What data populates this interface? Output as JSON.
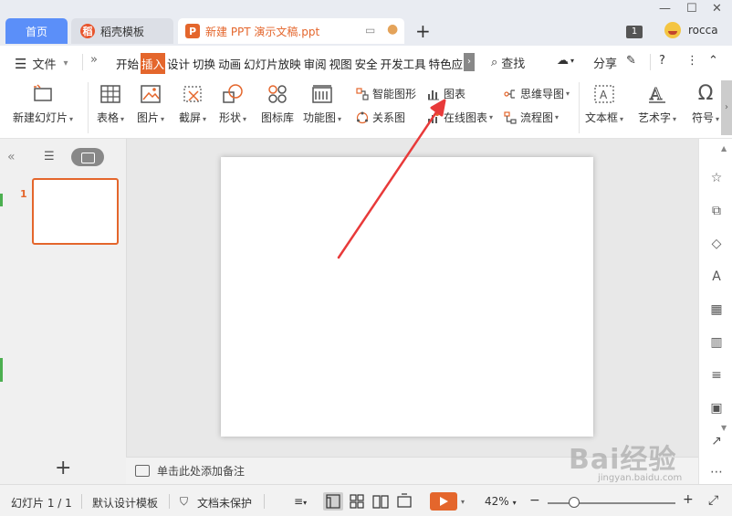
{
  "tabs": {
    "home": "首页",
    "template": "稻壳模板",
    "template_logo": "稻",
    "document": "新建 PPT 演示文稿.ppt",
    "document_logo": "P",
    "new_tab": "+"
  },
  "window": {
    "badge": "1",
    "user": "rocca"
  },
  "menu": {
    "file": "文件",
    "tabs": [
      "开始",
      "插入",
      "设计",
      "切换",
      "动画",
      "幻灯片放映",
      "审阅",
      "视图",
      "安全",
      "开发工具",
      "特色应"
    ],
    "active_tab": "插入",
    "search": "查找",
    "share": "分享"
  },
  "ribbon": {
    "new_slide": "新建幻灯片",
    "table": "表格",
    "picture": "图片",
    "screenshot": "截屏",
    "shape": "形状",
    "icon_lib": "图标库",
    "function_chart": "功能图",
    "smart_graphic": "智能图形",
    "chart": "图表",
    "relation": "关系图",
    "online_chart": "在线图表",
    "mind_map": "思维导图",
    "flowchart": "流程图",
    "textbox": "文本框",
    "wordart": "艺术字",
    "symbol": "符号"
  },
  "slides_pane": {
    "slide_number": "1",
    "add": "+"
  },
  "notes": {
    "placeholder": "单击此处添加备注"
  },
  "status": {
    "slide_counter": "幻灯片 1 / 1",
    "design_template": "默认设计模板",
    "doc_protection": "文档未保护",
    "zoom": "42%",
    "zoom_value": 0.42
  },
  "watermark": {
    "brand": "Bai经验",
    "url": "jingyan.baidu.com"
  },
  "accent_color": "#e4662c"
}
